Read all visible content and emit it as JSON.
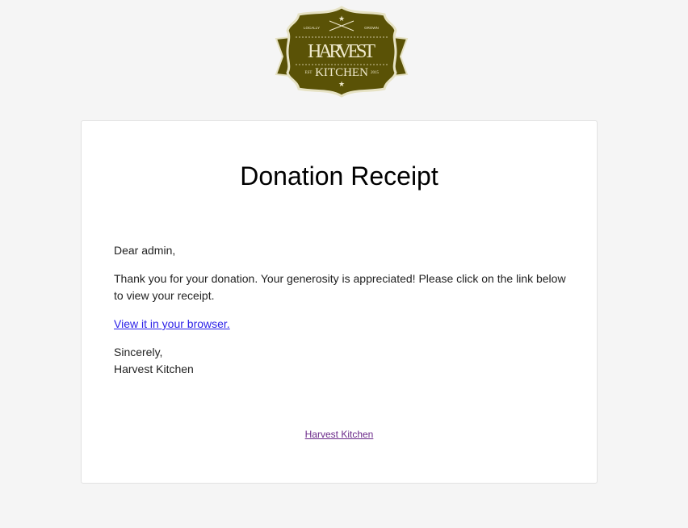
{
  "logo": {
    "top_left": "LOCALLY",
    "top_right": "GROWN",
    "line1": "HARVEST",
    "line2": "KITCHEN",
    "est": "EST",
    "year": "2015",
    "colors": {
      "fill": "#5a5206",
      "border": "#e6e2c4",
      "text": "#efe9cc"
    }
  },
  "email": {
    "title": "Donation Receipt",
    "greeting": "Dear admin,",
    "message": "Thank you for your donation. Your generosity is appreciated! Please click on the link below to view your receipt.",
    "link_label": "View it in your browser.",
    "closing": "Sincerely,",
    "signature": "Harvest Kitchen",
    "footer_link": "Harvest Kitchen"
  }
}
